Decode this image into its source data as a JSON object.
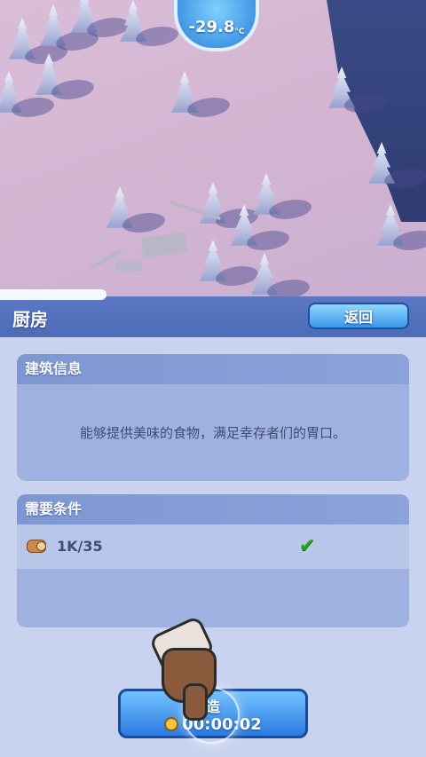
{
  "hud": {
    "temperature": "-29.8",
    "temperature_unit": "°C"
  },
  "header": {
    "title": "厨房",
    "back_label": "返回"
  },
  "info_panel": {
    "title": "建筑信息",
    "description": "能够提供美味的食物，满足幸存者们的胃口。"
  },
  "requirements_panel": {
    "title": "需要条件",
    "items": [
      {
        "icon": "wood-log-icon",
        "amount": "1K/35",
        "met": true,
        "status_icon": "checkmark-icon"
      }
    ]
  },
  "build_button": {
    "label": "造",
    "timer": "00:00:02",
    "icon": "clock-icon"
  },
  "colors": {
    "header": "#5b78c4",
    "panel": "#9fb1de",
    "button": "#3c96ea",
    "check": "#1ea51c"
  }
}
